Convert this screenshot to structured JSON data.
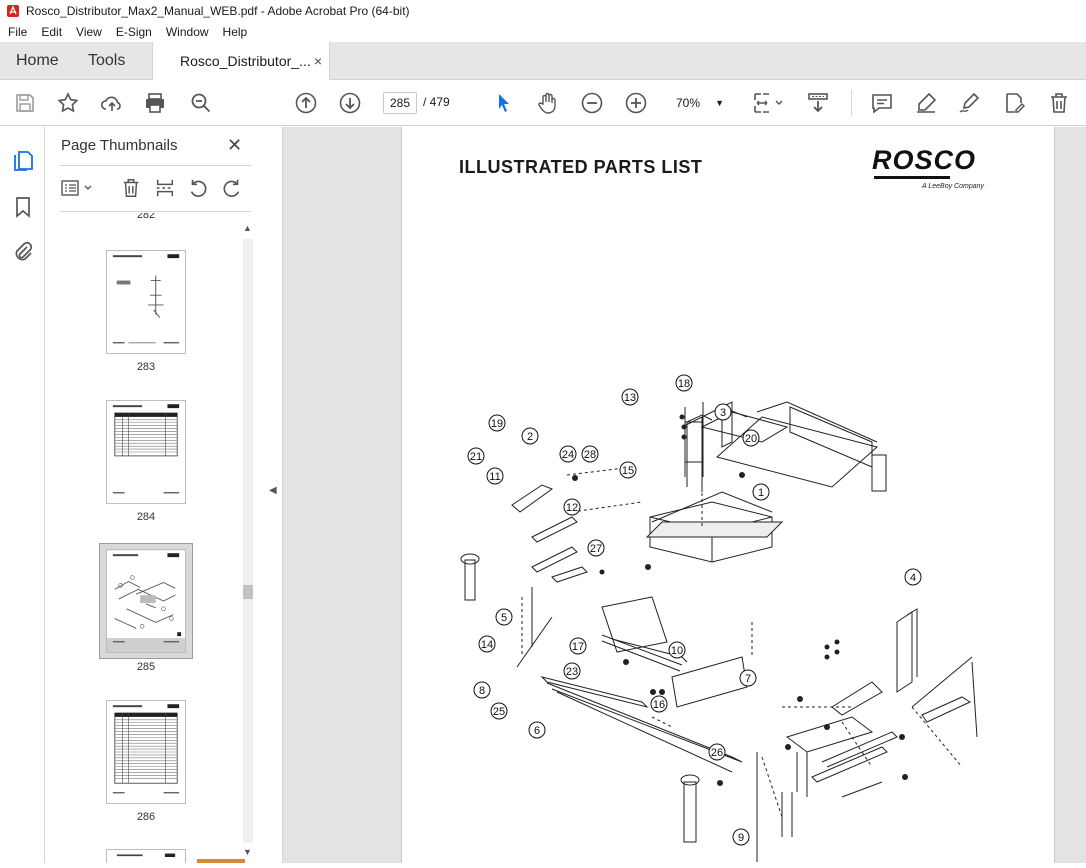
{
  "window": {
    "title": "Rosco_Distributor_Max2_Manual_WEB.pdf - Adobe Acrobat Pro (64-bit)"
  },
  "menu": [
    "File",
    "Edit",
    "View",
    "E-Sign",
    "Window",
    "Help"
  ],
  "tabs": {
    "home": "Home",
    "tools": "Tools",
    "document": "Rosco_Distributor_...",
    "close": "×"
  },
  "toolbar": {
    "page_current": "285",
    "page_total": "/  479",
    "zoom": "70%"
  },
  "panel": {
    "title": "Page Thumbnails",
    "close": "✕",
    "thumbnails": [
      {
        "label": "282"
      },
      {
        "label": "283"
      },
      {
        "label": "284"
      },
      {
        "label": "285",
        "selected": true
      },
      {
        "label": "286"
      }
    ]
  },
  "document": {
    "heading": "ILLUSTRATED PARTS LIST",
    "logo_text": "ROSCO",
    "logo_sub": "A LeeBoy Company",
    "callouts": [
      "1",
      "2",
      "3",
      "4",
      "5",
      "6",
      "7",
      "8",
      "9",
      "10",
      "11",
      "12",
      "13",
      "14",
      "15",
      "16",
      "17",
      "18",
      "19",
      "20",
      "21",
      "23",
      "24",
      "25",
      "26",
      "27",
      "28"
    ]
  },
  "colors": {
    "accent_blue": "#1473e6",
    "tab_bg": "#e6e6e6",
    "doc_bg": "#e3e3e3"
  }
}
